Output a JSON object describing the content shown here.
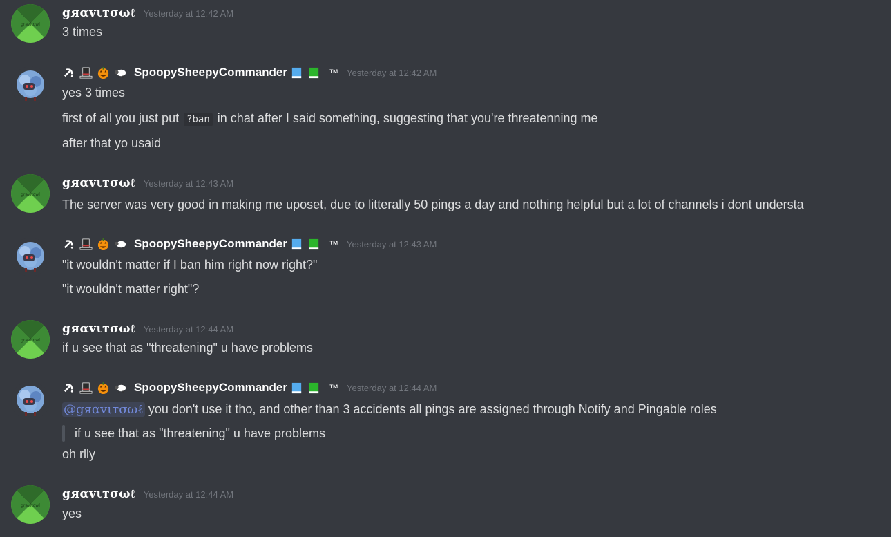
{
  "messages": {
    "m1": {
      "author": "gяαvιтσωℓ",
      "timestamp": "Yesterday at 12:42 AM",
      "lines": [
        "3 times"
      ]
    },
    "m2": {
      "author": "SpoopySheepyCommander",
      "trademark": "™",
      "timestamp": "Yesterday at 12:42 AM",
      "lines": [
        "yes 3 times"
      ],
      "l2_pre": "first of all you just put ",
      "l2_code": "?ban",
      "l2_post": " in chat after I said something, suggesting that you're threatenning me",
      "l3": "after that yo usaid"
    },
    "m3": {
      "author": "gяαvιтσωℓ",
      "timestamp": "Yesterday at 12:43 AM",
      "lines": [
        "The server was very good in making me uposet, due to litterally 50 pings a day and nothing helpful but a lot of channels i dont understa"
      ]
    },
    "m4": {
      "author": "SpoopySheepyCommander",
      "trademark": "™",
      "timestamp": "Yesterday at 12:43 AM",
      "lines": [
        "\"it wouldn't matter if I ban him right now right?\"",
        "\"it wouldn't matter right\"?"
      ]
    },
    "m5": {
      "author": "gяαvιтσωℓ",
      "timestamp": "Yesterday at 12:44 AM",
      "lines": [
        "if u see that as \"threatening\" u have problems"
      ]
    },
    "m6": {
      "author": "SpoopySheepyCommander",
      "trademark": "™",
      "timestamp": "Yesterday at 12:44 AM",
      "mention": "@gяαvιтσωℓ",
      "l1_post": " you don't use it tho, and other than 3 accidents all pings are assigned through Notify and Pingable roles",
      "quote": "if u see that as \"threatening\" u have problems",
      "l3": "oh rlly"
    },
    "m7": {
      "author": "gяαvιтσωℓ",
      "timestamp": "Yesterday at 12:44 AM",
      "lines": [
        "yes"
      ]
    }
  },
  "avatar_label": "gravitowl",
  "icons": {
    "spoopy_prefix": [
      "hammer-sickle-icon",
      "top-hat-icon",
      "jack-o-lantern-icon",
      "sheep-icon"
    ],
    "spoopy_suffix": [
      "blue-book-icon",
      "green-book-icon"
    ]
  },
  "colors": {
    "background": "#36393f",
    "text": "#dcddde",
    "username": "#ffffff",
    "timestamp": "#72767d",
    "mention": "#7289da",
    "avatar_dark_green": "#2f6b2a",
    "avatar_light_green": "#6fcf4f"
  }
}
